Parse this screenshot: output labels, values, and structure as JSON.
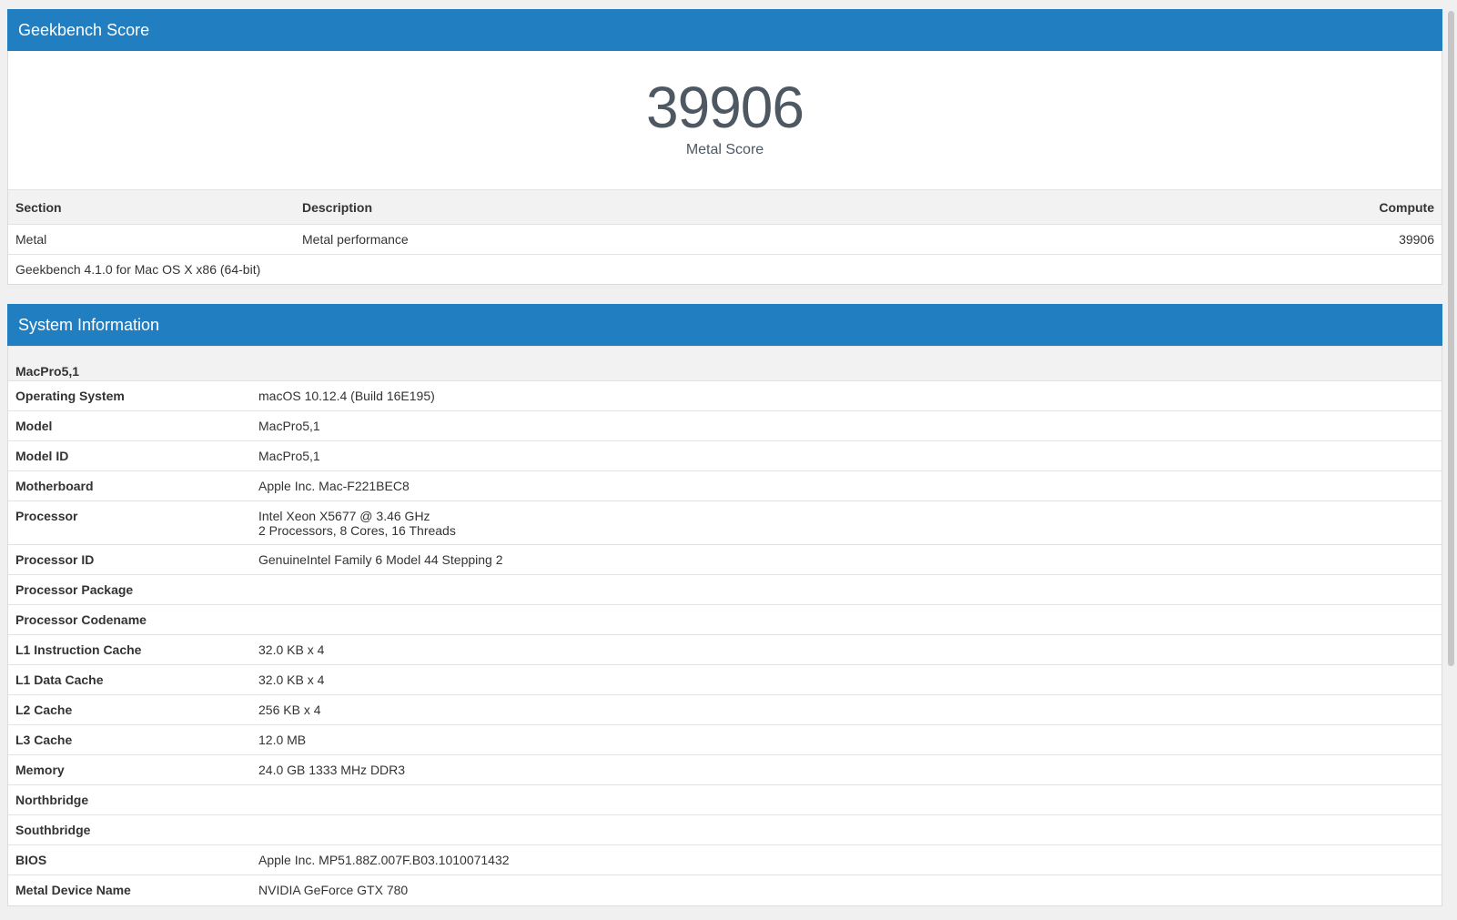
{
  "score_panel": {
    "title": "Geekbench Score",
    "score": "39906",
    "score_label": "Metal Score",
    "table": {
      "headers": {
        "section": "Section",
        "description": "Description",
        "compute": "Compute"
      },
      "rows": [
        {
          "section": "Metal",
          "description": "Metal performance",
          "compute": "39906"
        }
      ]
    },
    "footer": "Geekbench 4.1.0 for Mac OS X x86 (64-bit)"
  },
  "system_panel": {
    "title": "System Information",
    "model_heading": "MacPro5,1",
    "rows": [
      {
        "label": "Operating System",
        "value": "macOS 10.12.4 (Build 16E195)"
      },
      {
        "label": "Model",
        "value": "MacPro5,1"
      },
      {
        "label": "Model ID",
        "value": "MacPro5,1"
      },
      {
        "label": "Motherboard",
        "value": "Apple Inc. Mac-F221BEC8"
      },
      {
        "label": "Processor",
        "value": "Intel Xeon X5677 @ 3.46 GHz",
        "value2": "2 Processors, 8 Cores, 16 Threads"
      },
      {
        "label": "Processor ID",
        "value": "GenuineIntel Family 6 Model 44 Stepping 2"
      },
      {
        "label": "Processor Package",
        "value": ""
      },
      {
        "label": "Processor Codename",
        "value": ""
      },
      {
        "label": "L1 Instruction Cache",
        "value": "32.0 KB x 4"
      },
      {
        "label": "L1 Data Cache",
        "value": "32.0 KB x 4"
      },
      {
        "label": "L2 Cache",
        "value": "256 KB x 4"
      },
      {
        "label": "L3 Cache",
        "value": "12.0 MB"
      },
      {
        "label": "Memory",
        "value": "24.0 GB 1333 MHz DDR3"
      },
      {
        "label": "Northbridge",
        "value": ""
      },
      {
        "label": "Southbridge",
        "value": ""
      },
      {
        "label": "BIOS",
        "value": "Apple Inc. MP51.88Z.007F.B03.1010071432"
      },
      {
        "label": "Metal Device Name",
        "value": "NVIDIA GeForce GTX 780"
      }
    ]
  },
  "colors": {
    "header_blue": "#217ec1",
    "score_text": "#4d5862",
    "page_bg": "#f0f0f0"
  }
}
